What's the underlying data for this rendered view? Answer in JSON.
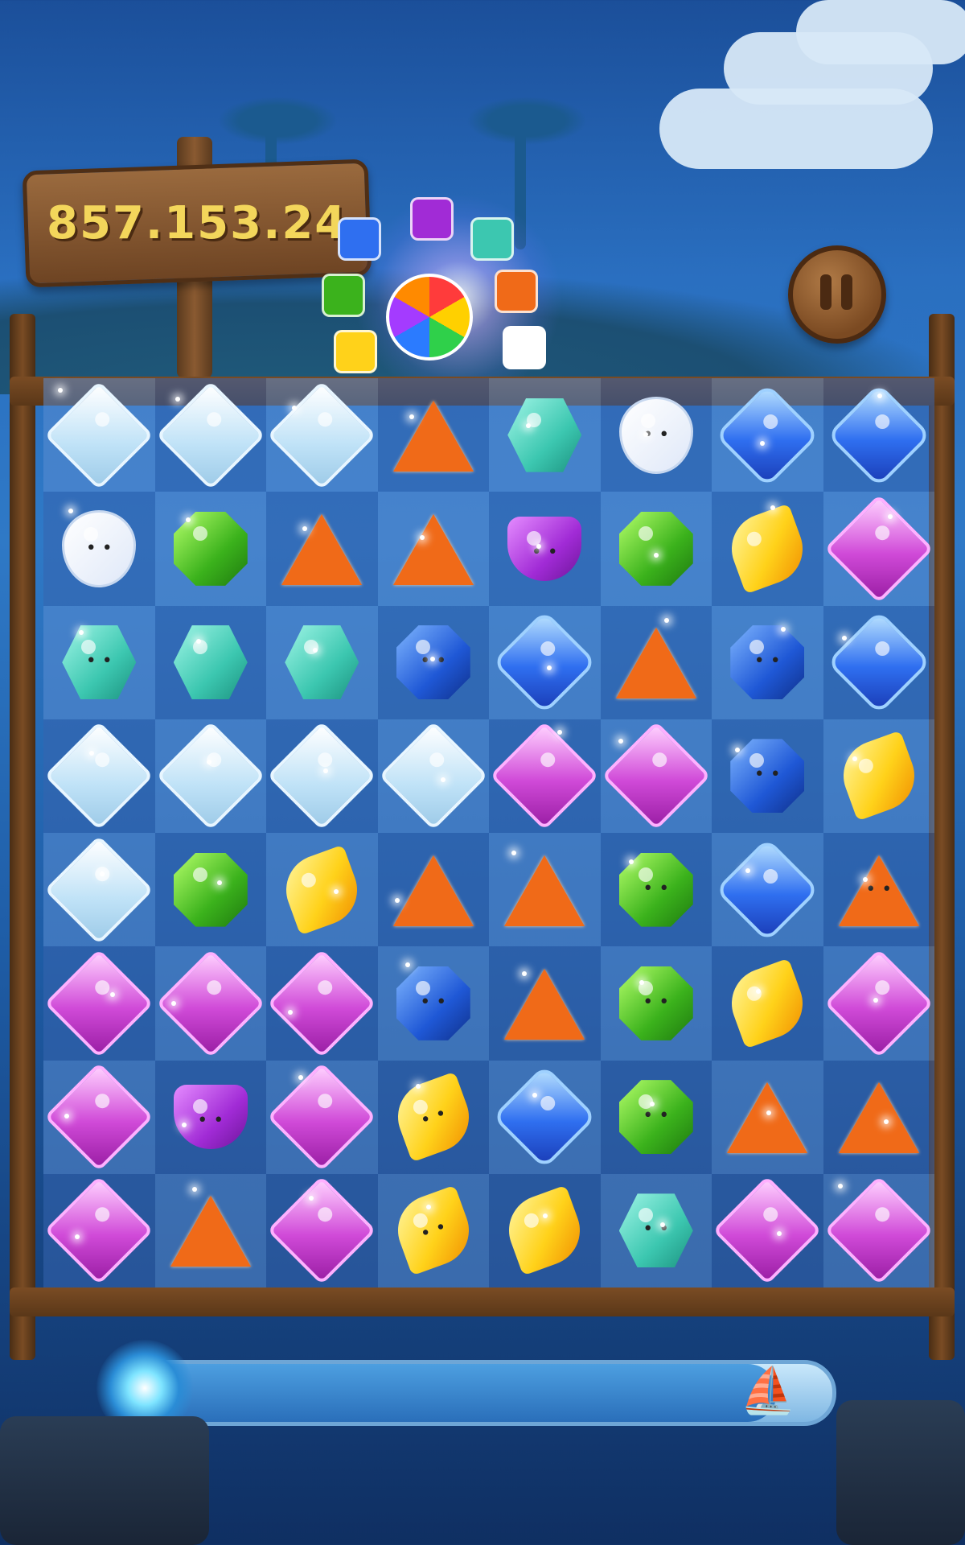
{
  "score": "857.153.24",
  "pause_icon": "pause-icon",
  "progress": 0.92,
  "progress_end_icon": "ship-icon",
  "progress_start_icon": "vortex-icon",
  "board": [
    [
      "diamond",
      "diamond",
      "diamond",
      "tri",
      "hex",
      "ghost",
      "blue",
      "blue"
    ],
    [
      "ghost",
      "green",
      "tri",
      "tri",
      "purple",
      "green",
      "yellow",
      "pink"
    ],
    [
      "hexface",
      "hex",
      "hex",
      "octa",
      "blue",
      "tri",
      "octa",
      "blue"
    ],
    [
      "diamond",
      "diamond",
      "diamond",
      "diamond",
      "pink",
      "pink",
      "octa",
      "yellow"
    ],
    [
      "diamond",
      "green",
      "yellow",
      "tri",
      "tri",
      "greenface",
      "blue",
      "triface"
    ],
    [
      "pink",
      "pink",
      "pink",
      "octa",
      "tri",
      "greenface",
      "yellow",
      "pink"
    ],
    [
      "pink",
      "purple",
      "pink",
      "yellowface",
      "blue",
      "greenface",
      "tri",
      "tri"
    ],
    [
      "pink",
      "tri",
      "pink",
      "yellowface",
      "yellow",
      "hexface",
      "pink",
      "pink"
    ]
  ]
}
